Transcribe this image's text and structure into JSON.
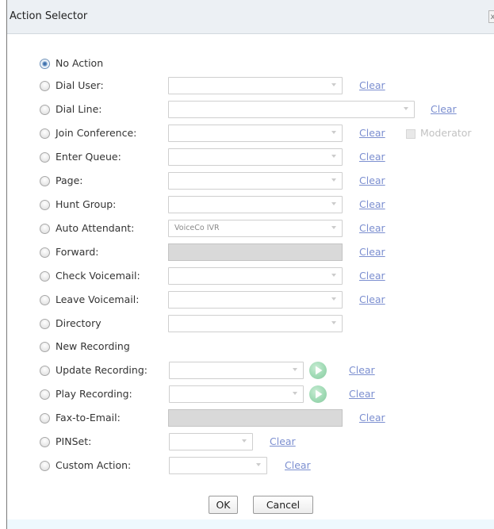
{
  "dialog": {
    "title": "Action Selector",
    "close_glyph": "x"
  },
  "actions": [
    {
      "label": "No Action",
      "checked": true
    },
    {
      "label": "Dial User:",
      "clear": "Clear"
    },
    {
      "label": "Dial Line:",
      "clear": "Clear"
    },
    {
      "label": "Join Conference:",
      "clear": "Clear",
      "moderator": "Moderator"
    },
    {
      "label": "Enter Queue:",
      "clear": "Clear"
    },
    {
      "label": "Page:",
      "clear": "Clear"
    },
    {
      "label": "Hunt Group:",
      "clear": "Clear"
    },
    {
      "label": "Auto Attendant:",
      "value": "VoiceCo IVR",
      "clear": "Clear"
    },
    {
      "label": "Forward:",
      "clear": "Clear"
    },
    {
      "label": "Check Voicemail:",
      "clear": "Clear"
    },
    {
      "label": "Leave Voicemail:",
      "clear": "Clear"
    },
    {
      "label": "Directory"
    },
    {
      "label": "New Recording"
    },
    {
      "label": "Update Recording:",
      "clear": "Clear"
    },
    {
      "label": "Play Recording:",
      "clear": "Clear"
    },
    {
      "label": "Fax-to-Email:",
      "clear": "Clear"
    },
    {
      "label": "PINSet:",
      "clear": "Clear"
    },
    {
      "label": "Custom Action:",
      "clear": "Clear"
    }
  ],
  "buttons": {
    "ok": "OK",
    "cancel": "Cancel"
  },
  "icons": {
    "play": "play-icon",
    "close": "close-icon"
  },
  "colors": {
    "link": "#7c8fd0",
    "titlebar": "#ecf0f4",
    "selected_radio": "#2f5f9c",
    "play_green": "#9fdab4"
  }
}
